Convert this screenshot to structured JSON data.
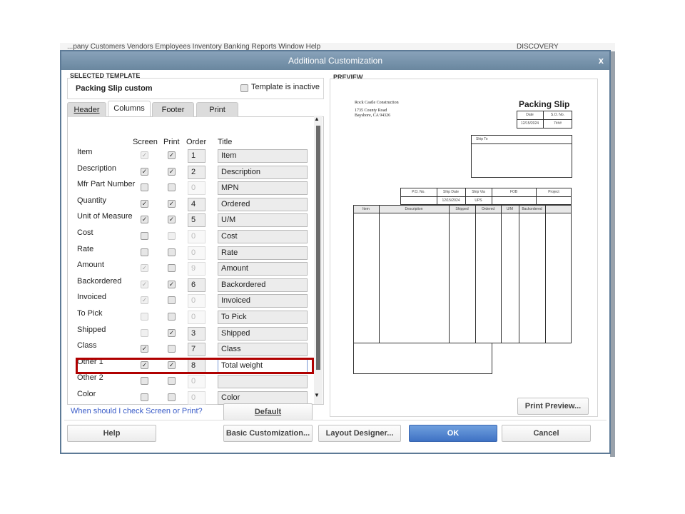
{
  "app_menu": "...pany   Customers   Vendors   Employees   Inventory   Banking   Reports   Window   Help",
  "app_discovery": "DISCOVERY",
  "dialog": {
    "title": "Additional Customization",
    "close": "x"
  },
  "selected_template": {
    "group_label": "SELECTED TEMPLATE",
    "name": "Packing Slip custom",
    "inactive_label": "Template is inactive",
    "inactive_checked": false
  },
  "tabs": [
    {
      "label": "Header"
    },
    {
      "label": "Columns",
      "active": true
    },
    {
      "label": "Footer"
    },
    {
      "label": "Print"
    }
  ],
  "columns_header": {
    "screen": "Screen",
    "print": "Print",
    "order": "Order",
    "title": "Title"
  },
  "rows": [
    {
      "label": "Item",
      "screen": "checked-disabled",
      "print": "checked",
      "order": "1",
      "order_enabled": true,
      "title": "Item"
    },
    {
      "label": "Description",
      "screen": "checked",
      "print": "checked",
      "order": "2",
      "order_enabled": true,
      "title": "Description"
    },
    {
      "label": "Mfr Part Number",
      "screen": "unchecked",
      "print": "unchecked",
      "order": "0",
      "order_enabled": false,
      "title": "MPN"
    },
    {
      "label": "Quantity",
      "screen": "checked",
      "print": "checked",
      "order": "4",
      "order_enabled": true,
      "title": "Ordered"
    },
    {
      "label": "Unit of Measure",
      "screen": "checked",
      "print": "checked",
      "order": "5",
      "order_enabled": true,
      "title": "U/M"
    },
    {
      "label": "Cost",
      "screen": "unchecked",
      "print": "unchecked-disabled",
      "order": "0",
      "order_enabled": false,
      "title": "Cost"
    },
    {
      "label": "Rate",
      "screen": "unchecked",
      "print": "unchecked",
      "order": "0",
      "order_enabled": false,
      "title": "Rate"
    },
    {
      "label": "Amount",
      "screen": "checked-disabled",
      "print": "unchecked",
      "order": "9",
      "order_enabled": false,
      "title": "Amount"
    },
    {
      "label": "Backordered",
      "screen": "checked-disabled",
      "print": "checked",
      "order": "6",
      "order_enabled": true,
      "title": "Backordered"
    },
    {
      "label": "Invoiced",
      "screen": "checked-disabled",
      "print": "unchecked",
      "order": "0",
      "order_enabled": false,
      "title": "Invoiced"
    },
    {
      "label": "To Pick",
      "screen": "unchecked-disabled",
      "print": "unchecked",
      "order": "0",
      "order_enabled": false,
      "title": "To Pick"
    },
    {
      "label": "Shipped",
      "screen": "unchecked-disabled",
      "print": "checked",
      "order": "3",
      "order_enabled": true,
      "title": "Shipped"
    },
    {
      "label": "Class",
      "screen": "checked",
      "print": "unchecked",
      "order": "7",
      "order_enabled": true,
      "title": "Class"
    },
    {
      "label": "Other 1",
      "screen": "checked",
      "print": "checked",
      "order": "8",
      "order_enabled": true,
      "title": "Total weight",
      "highlighted": true,
      "focused": true
    },
    {
      "label": "Other 2",
      "screen": "unchecked",
      "print": "unchecked",
      "order": "0",
      "order_enabled": false,
      "title": ""
    },
    {
      "label": "Color",
      "screen": "unchecked",
      "print": "unchecked",
      "order": "0",
      "order_enabled": false,
      "title": "Color"
    }
  ],
  "help_link": "When should I check Screen or Print?",
  "highlight_color": "#b00000",
  "preview": {
    "group_label": "PREVIEW",
    "company": "Rock Castle Construction",
    "address1": "1735 County Road",
    "address2": "Bayshore, CA 94326",
    "doc_title": "Packing Slip",
    "date_label": "Date",
    "so_label": "S.O. No.",
    "date_value": "12/15/2024",
    "so_value": "7### ",
    "ship_to": "Ship To",
    "info_headers": [
      "P.O. No.",
      "Ship Date",
      "Ship Via",
      "FOB",
      "Project"
    ],
    "info_values": [
      "",
      "12/15/2024",
      "UPS",
      "",
      ""
    ],
    "col_headers": [
      "Item",
      "Description",
      "Shipped",
      "Ordered",
      "U/M",
      "Backordered",
      ""
    ]
  },
  "buttons": {
    "default": "Default",
    "print_preview": "Print Preview...",
    "help": "Help",
    "basic": "Basic Customization...",
    "layout": "Layout Designer...",
    "ok": "OK",
    "cancel": "Cancel"
  }
}
